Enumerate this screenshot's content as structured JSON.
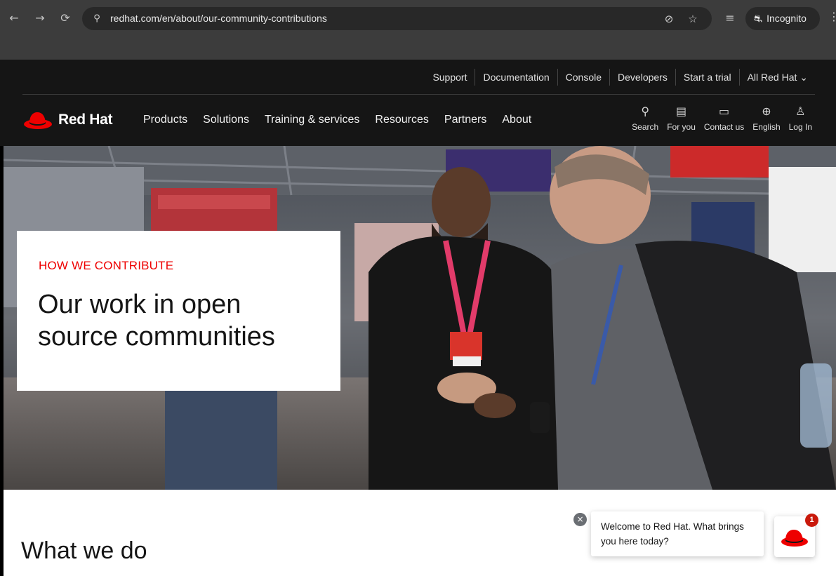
{
  "browser": {
    "url": "redhat.com/en/about/our-community-contributions",
    "incognito_label": "Incognito",
    "back_glyph": "←",
    "forward_glyph": "→",
    "reload_glyph": "⟳",
    "tune_glyph": "⚲",
    "eye_off_glyph": "⊘",
    "star_glyph": "☆",
    "reading_glyph": "≡",
    "incognito_glyph": "⛐",
    "menu_glyph": "⋮"
  },
  "utility_nav": {
    "items": [
      "Support",
      "Documentation",
      "Console",
      "Developers",
      "Start a trial",
      "All Red Hat ⌄"
    ]
  },
  "brand": {
    "name": "Red Hat",
    "color": "#ee0000"
  },
  "main_nav": {
    "items": [
      "Products",
      "Solutions",
      "Training & services",
      "Resources",
      "Partners",
      "About"
    ]
  },
  "tools": [
    {
      "label": "Search",
      "icon": "search-icon",
      "glyph": "⚲"
    },
    {
      "label": "For you",
      "icon": "document-icon",
      "glyph": "▤"
    },
    {
      "label": "Contact us",
      "icon": "chat-icon",
      "glyph": "▭"
    },
    {
      "label": "English",
      "icon": "globe-icon",
      "glyph": "⊕"
    },
    {
      "label": "Log In",
      "icon": "user-icon",
      "glyph": "♙"
    }
  ],
  "hero": {
    "eyebrow": "HOW WE CONTRIBUTE",
    "title": "Our work in open source communities"
  },
  "section": {
    "title": "What we do"
  },
  "chat": {
    "close_glyph": "×",
    "message": "Welcome to Red Hat. What brings you here today?",
    "badge_count": "1"
  }
}
